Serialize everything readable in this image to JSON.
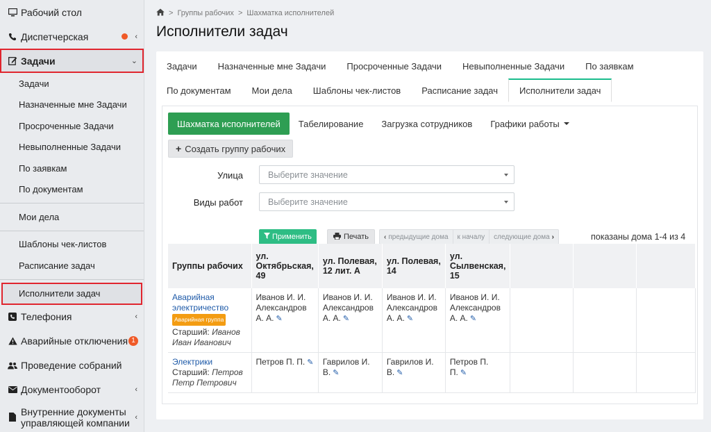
{
  "sidebar": {
    "items": [
      {
        "label": "Рабочий стол"
      },
      {
        "label": "Диспетчерская"
      },
      {
        "label": "Задачи"
      }
    ],
    "tasks_sub": [
      {
        "label": "Задачи"
      },
      {
        "label": "Назначенные мне Задачи"
      },
      {
        "label": "Просроченные Задачи"
      },
      {
        "label": "Невыполненные Задачи"
      },
      {
        "label": "По заявкам"
      },
      {
        "label": "По документам"
      }
    ],
    "tasks_sub2": [
      {
        "label": "Мои дела"
      }
    ],
    "tasks_sub3": [
      {
        "label": "Шаблоны чек-листов"
      },
      {
        "label": "Расписание задач"
      }
    ],
    "tasks_sub4": [
      {
        "label": "Исполнители задач"
      }
    ],
    "bottom": [
      {
        "label": "Телефония"
      },
      {
        "label": "Аварийные отключения",
        "badge": "1"
      },
      {
        "label": "Проведение собраний"
      },
      {
        "label": "Документооборот"
      },
      {
        "label": "Внутренние документы управляющей компании"
      }
    ]
  },
  "breadcrumb": {
    "part1": "Группы рабочих",
    "sep": ">",
    "part2": "Шахматка исполнителей"
  },
  "page_title": "Исполнители задач",
  "tabs_row1": [
    "Задачи",
    "Назначенные мне Задачи",
    "Просроченные Задачи",
    "Невыполненные Задачи",
    "По заявкам"
  ],
  "tabs_row2": [
    "По документам",
    "Мои дела",
    "Шаблоны чек-листов",
    "Расписание задач",
    "Исполнители задач"
  ],
  "pills": [
    "Шахматка исполнителей",
    "Табелирование",
    "Загрузка сотрудников",
    "Графики работы"
  ],
  "create_button": "Создать группу рабочих",
  "filters": {
    "street_label": "Улица",
    "street_placeholder": "Выберите значение",
    "worktype_label": "Виды работ",
    "worktype_placeholder": "Выберите значение"
  },
  "apply_button": "Применить",
  "print_button": "Печать",
  "pager": {
    "prev": "предыдущие дома",
    "start": "к началу",
    "next": "следующие дома"
  },
  "shown_text": "показаны дома 1-4 из 4",
  "table": {
    "headers": [
      "Группы рабочих",
      "ул. Октябрьская, 49",
      "ул. Полевая, 12 лит. А",
      "ул. Полевая, 14",
      "ул. Сылвенская, 15"
    ],
    "rows": [
      {
        "group": "Аварийная электричество",
        "badge": "Аварийная группа",
        "senior_label": "Старший:",
        "senior": "Иванов Иван Иванович",
        "cells": [
          "Иванов И. И. Александров А. А.",
          "Иванов И. И. Александров А. А.",
          "Иванов И. И. Александров А. А.",
          "Иванов И. И. Александров А. А."
        ]
      },
      {
        "group": "Электрики",
        "senior_label": "Старший:",
        "senior": "Петров Петр Петрович",
        "cells": [
          "Петров П. П.",
          "Гаврилов И. В.",
          "Гаврилов И. В.",
          "Петров П. П."
        ]
      }
    ]
  }
}
